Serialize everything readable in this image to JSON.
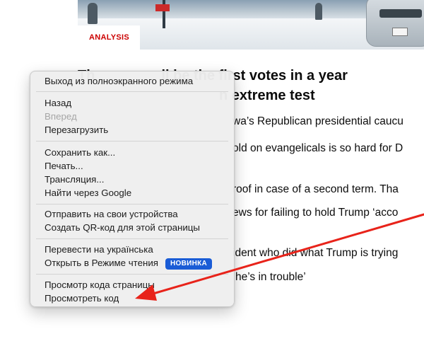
{
  "article": {
    "kicker": "ANALYSIS",
    "headline_line1": "The ...e first votes in a year",
    "headline_line1_visible": "ll be the first votes in a year",
    "headline_line1_prefix": "Th",
    "headline_line2": "n extreme test",
    "paragraphs": [
      "wa’s Republican presidential caucu",
      "old on evangelicals is so hard for D",
      "roof in case of a second term. Tha",
      "ews for failing to hold Trump ‘acco",
      "ident who did what Trump is trying",
      "he’s in trouble’"
    ]
  },
  "context_menu": {
    "groups": [
      [
        {
          "label": "Выход из полноэкранного режима",
          "enabled": true
        }
      ],
      [
        {
          "label": "Назад",
          "enabled": true
        },
        {
          "label": "Вперед",
          "enabled": false
        },
        {
          "label": "Перезагрузить",
          "enabled": true
        }
      ],
      [
        {
          "label": "Сохранить как...",
          "enabled": true
        },
        {
          "label": "Печать...",
          "enabled": true
        },
        {
          "label": "Трансляция...",
          "enabled": true
        },
        {
          "label": "Найти через Google",
          "enabled": true
        }
      ],
      [
        {
          "label": "Отправить на свои устройства",
          "enabled": true
        },
        {
          "label": "Создать QR-код для этой страницы",
          "enabled": true
        }
      ],
      [
        {
          "label": "Перевести на украïнська",
          "enabled": true
        },
        {
          "label": "Открыть в Режиме чтения",
          "enabled": true,
          "badge": "НОВИНКА"
        }
      ],
      [
        {
          "label": "Просмотр кода страницы",
          "enabled": true
        },
        {
          "label": "Просмотреть код",
          "enabled": true
        }
      ]
    ]
  },
  "colors": {
    "kicker": "#cc0000",
    "badge_bg": "#1a5cd6",
    "arrow": "#e8231a"
  }
}
